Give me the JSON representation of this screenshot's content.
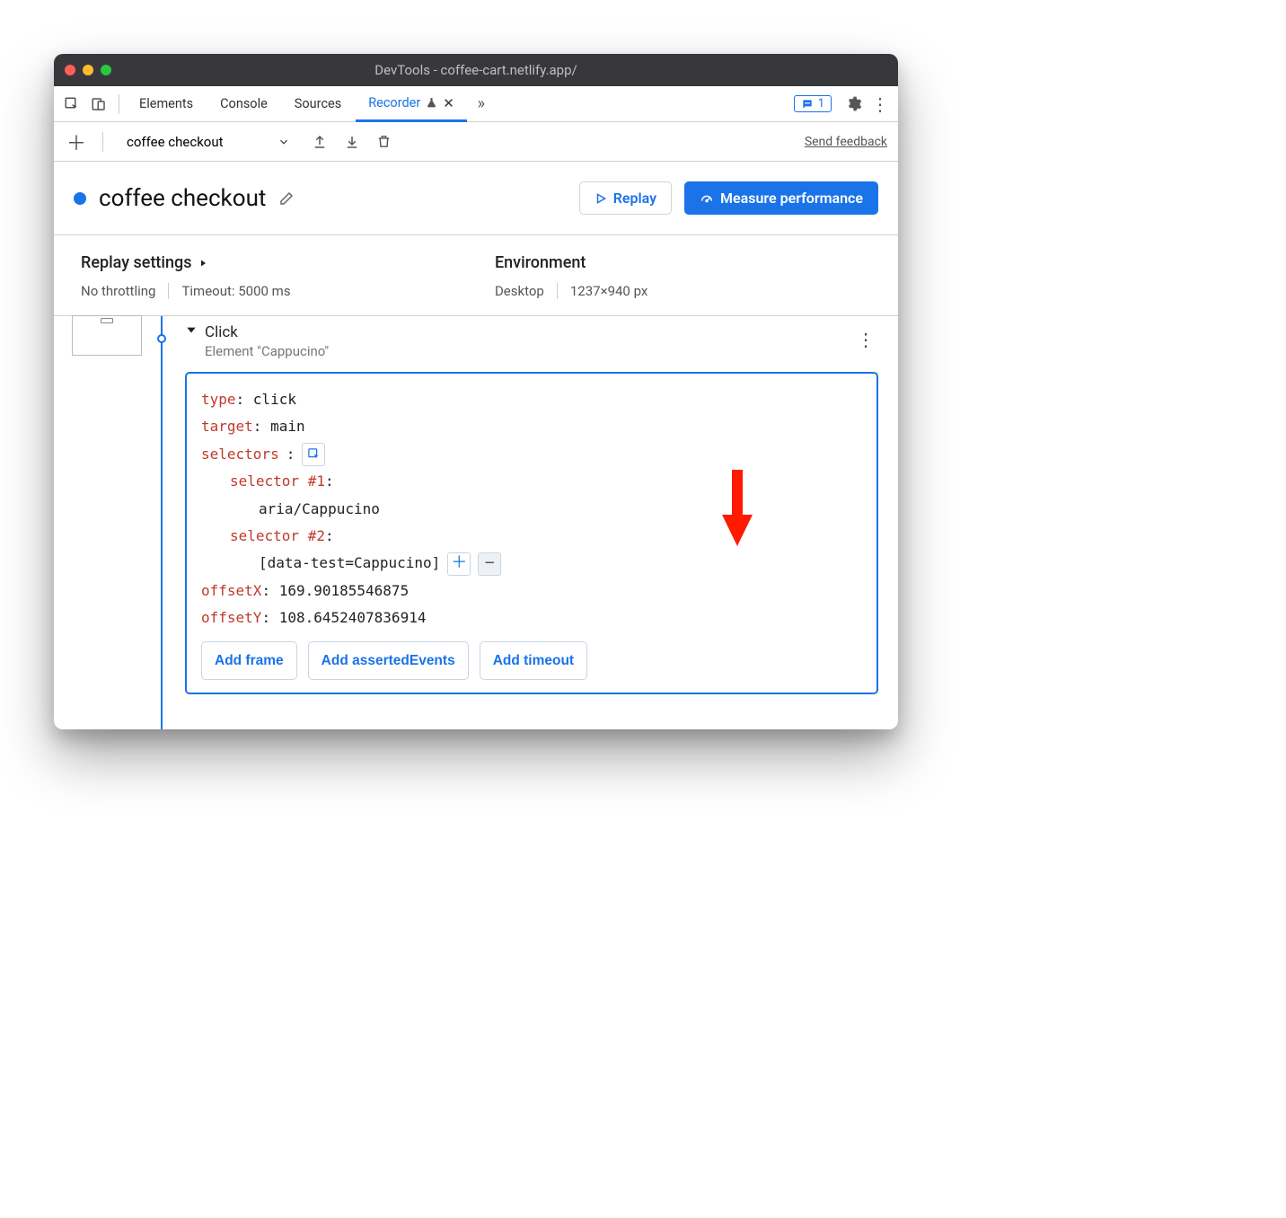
{
  "titlebar": {
    "title": "DevTools - coffee-cart.netlify.app/"
  },
  "tabs": {
    "elements": "Elements",
    "console": "Console",
    "sources": "Sources",
    "recorder": "Recorder",
    "messages_count": "1"
  },
  "toolbar": {
    "dropdown_value": "coffee checkout",
    "send_feedback": "Send feedback"
  },
  "header": {
    "title": "coffee checkout",
    "replay": "Replay",
    "measure": "Measure performance"
  },
  "settings": {
    "replay_title": "Replay settings",
    "throttling": "No throttling",
    "timeout": "Timeout: 5000 ms",
    "env_title": "Environment",
    "device": "Desktop",
    "viewport": "1237×940 px"
  },
  "step": {
    "title": "Click",
    "subtitle": "Element \"Cappucino\"",
    "detail": {
      "type_k": "type",
      "type_v": ": click",
      "target_k": "target",
      "target_v": ": main",
      "selectors_k": "selectors",
      "selectors_colon": ":",
      "sel1_k": "selector #1",
      "sel1_colon": ":",
      "sel1_v": "aria/Cappucino",
      "sel2_k": "selector #2",
      "sel2_colon": ":",
      "sel2_v": "[data-test=Cappucino]",
      "offsetx_k": "offsetX",
      "offsetx_v": ": 169.90185546875",
      "offsety_k": "offsetY",
      "offsety_v": ": 108.6452407836914"
    },
    "pills": {
      "add_frame": "Add frame",
      "add_asserted": "Add assertedEvents",
      "add_timeout": "Add timeout"
    }
  }
}
